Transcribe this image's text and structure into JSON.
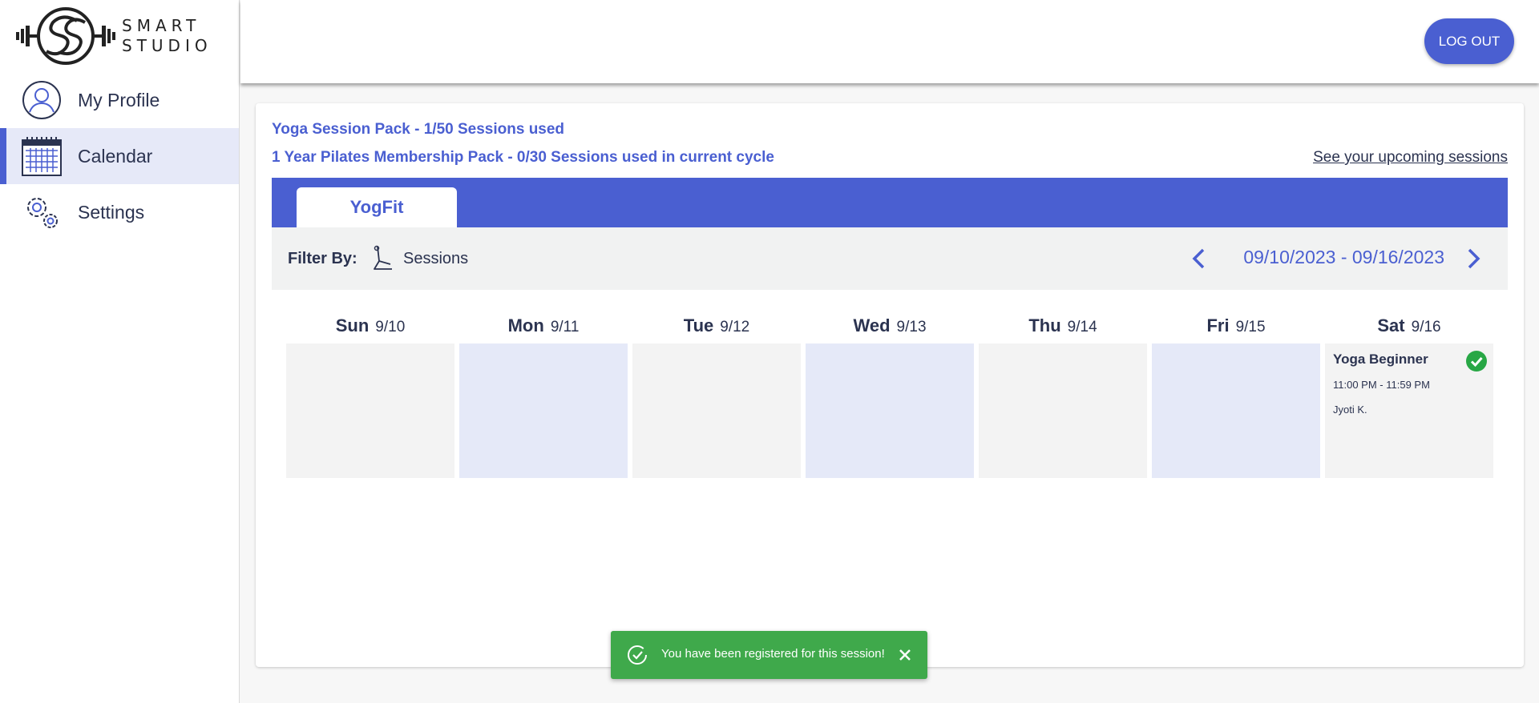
{
  "brand": {
    "logo_text_line1": "SMART",
    "logo_text_line2": "STUDIO"
  },
  "sidebar": {
    "items": [
      {
        "label": "My Profile",
        "icon": "user-circle-icon"
      },
      {
        "label": "Calendar",
        "icon": "calendar-icon",
        "active": true
      },
      {
        "label": "Settings",
        "icon": "gears-icon"
      }
    ]
  },
  "header": {
    "logout_label": "LOG OUT"
  },
  "packs": {
    "line1": "Yoga Session Pack - 1/50 Sessions used",
    "line2": "1 Year Pilates Membership Pack - 0/30 Sessions used in current cycle",
    "upcoming_link": "See your upcoming sessions"
  },
  "tabs": [
    {
      "label": "YogFit",
      "active": true
    }
  ],
  "filter": {
    "label": "Filter By:",
    "option": "Sessions",
    "date_range": "09/10/2023 - 09/16/2023"
  },
  "calendar": {
    "days": [
      {
        "name": "Sun",
        "date": "9/10"
      },
      {
        "name": "Mon",
        "date": "9/11"
      },
      {
        "name": "Tue",
        "date": "9/12"
      },
      {
        "name": "Wed",
        "date": "9/13"
      },
      {
        "name": "Thu",
        "date": "9/14"
      },
      {
        "name": "Fri",
        "date": "9/15"
      },
      {
        "name": "Sat",
        "date": "9/16"
      }
    ],
    "session": {
      "title": "Yoga Beginner",
      "time": "11:00 PM - 11:59 PM",
      "instructor": "Jyoti K.",
      "registered": true
    }
  },
  "toast": {
    "message": "You have been registered for this session!"
  },
  "colors": {
    "accent": "#4a5fd1",
    "success": "#3fa94b",
    "active_bg": "#e6e9f8"
  }
}
